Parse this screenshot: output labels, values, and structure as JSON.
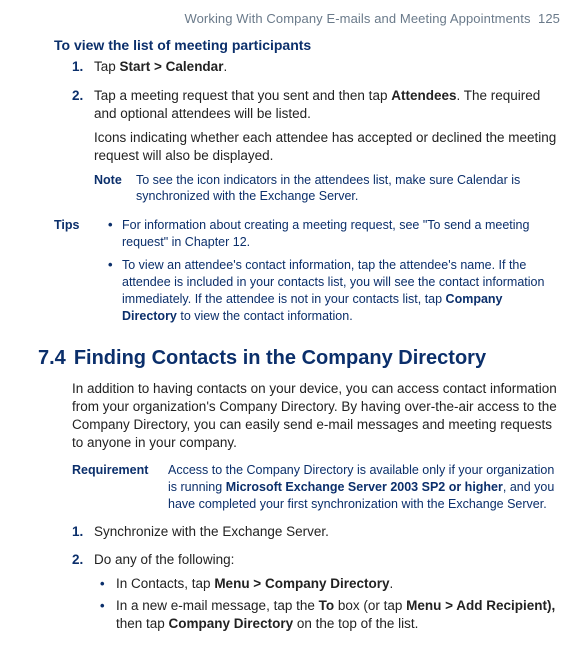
{
  "header": {
    "text": "Working With Company E-mails and Meeting Appointments",
    "page": "125"
  },
  "section1": {
    "title": "To view the list of meeting participants",
    "steps": [
      {
        "num": "1.",
        "text_pre": "Tap ",
        "strong": "Start > Calendar",
        "text_post": "."
      },
      {
        "num": "2.",
        "para1_pre": "Tap a meeting request that you sent and then tap ",
        "para1_strong": "Attendees",
        "para1_post": ". The required and optional attendees will be listed.",
        "para2": "Icons indicating whether each attendee has accepted or declined the meeting request will also be displayed.",
        "note_label": "Note",
        "note_text": "To see the icon indicators in the attendees list, make sure Calendar is synchronized with the Exchange Server."
      }
    ],
    "tips_label": "Tips",
    "tips": [
      {
        "bullet": "•",
        "text": "For information about creating a meeting request, see \"To send a meeting request\" in Chapter 12."
      },
      {
        "bullet": "•",
        "text_pre": "To view an attendee's contact information, tap the attendee's name. If the attendee is included in your contacts list, you will see the contact information immediately. If the attendee is not in your contacts list, tap ",
        "strong": "Company Directory",
        "text_post": " to view the contact information."
      }
    ]
  },
  "section2": {
    "num": "7.4",
    "title": "Finding Contacts in the Company Directory",
    "intro": "In addition to having contacts on your device, you can access contact information from your organization's Company Directory. By having over-the-air access to the Company Directory, you can easily send e-mail messages and meeting requests to anyone in your company.",
    "req_label": "Requirement",
    "req_pre": "Access to the Company Directory is available only if your organization is running ",
    "req_strong": "Microsoft Exchange Server 2003 SP2 or higher",
    "req_post": ", and you have completed your first synchronization with the Exchange Server.",
    "steps": [
      {
        "num": "1.",
        "text": "Synchronize with the Exchange Server."
      },
      {
        "num": "2.",
        "text": "Do any of the following:",
        "sub": [
          {
            "bullet": "•",
            "pre": "In Contacts, tap ",
            "strong": "Menu > Company Directory",
            "post": "."
          },
          {
            "bullet": "•",
            "pre": "In a new e-mail message, tap the ",
            "strong1": "To",
            "mid": " box (or tap ",
            "strong2": "Menu > Add Recipient),",
            "mid2": " then tap ",
            "strong3": "Company Directory",
            "post": " on the top of the list."
          }
        ]
      }
    ]
  }
}
